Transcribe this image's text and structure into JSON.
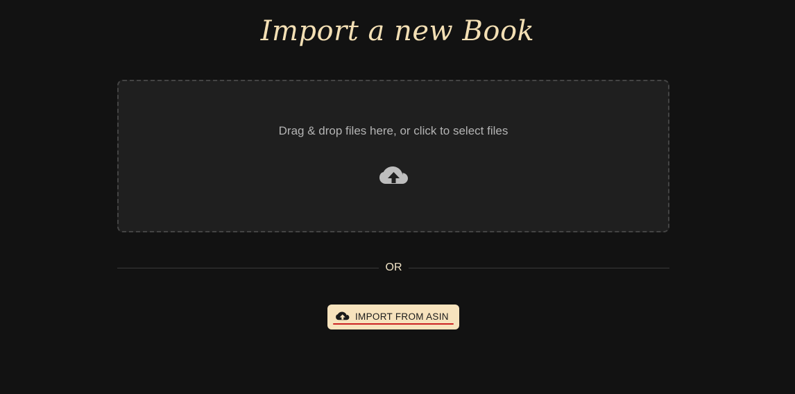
{
  "page": {
    "title": "Import a new Book"
  },
  "dropzone": {
    "text": "Drag & drop files here, or click to select files",
    "icon": "cloud-upload-icon"
  },
  "divider": {
    "label": "OR"
  },
  "import_button": {
    "label": "IMPORT FROM ASIN",
    "icon": "cloud-upload-icon"
  },
  "colors": {
    "background": "#121212",
    "accent": "#f7e3bd",
    "title": "#f3dfb4",
    "underline": "#cc2222"
  }
}
